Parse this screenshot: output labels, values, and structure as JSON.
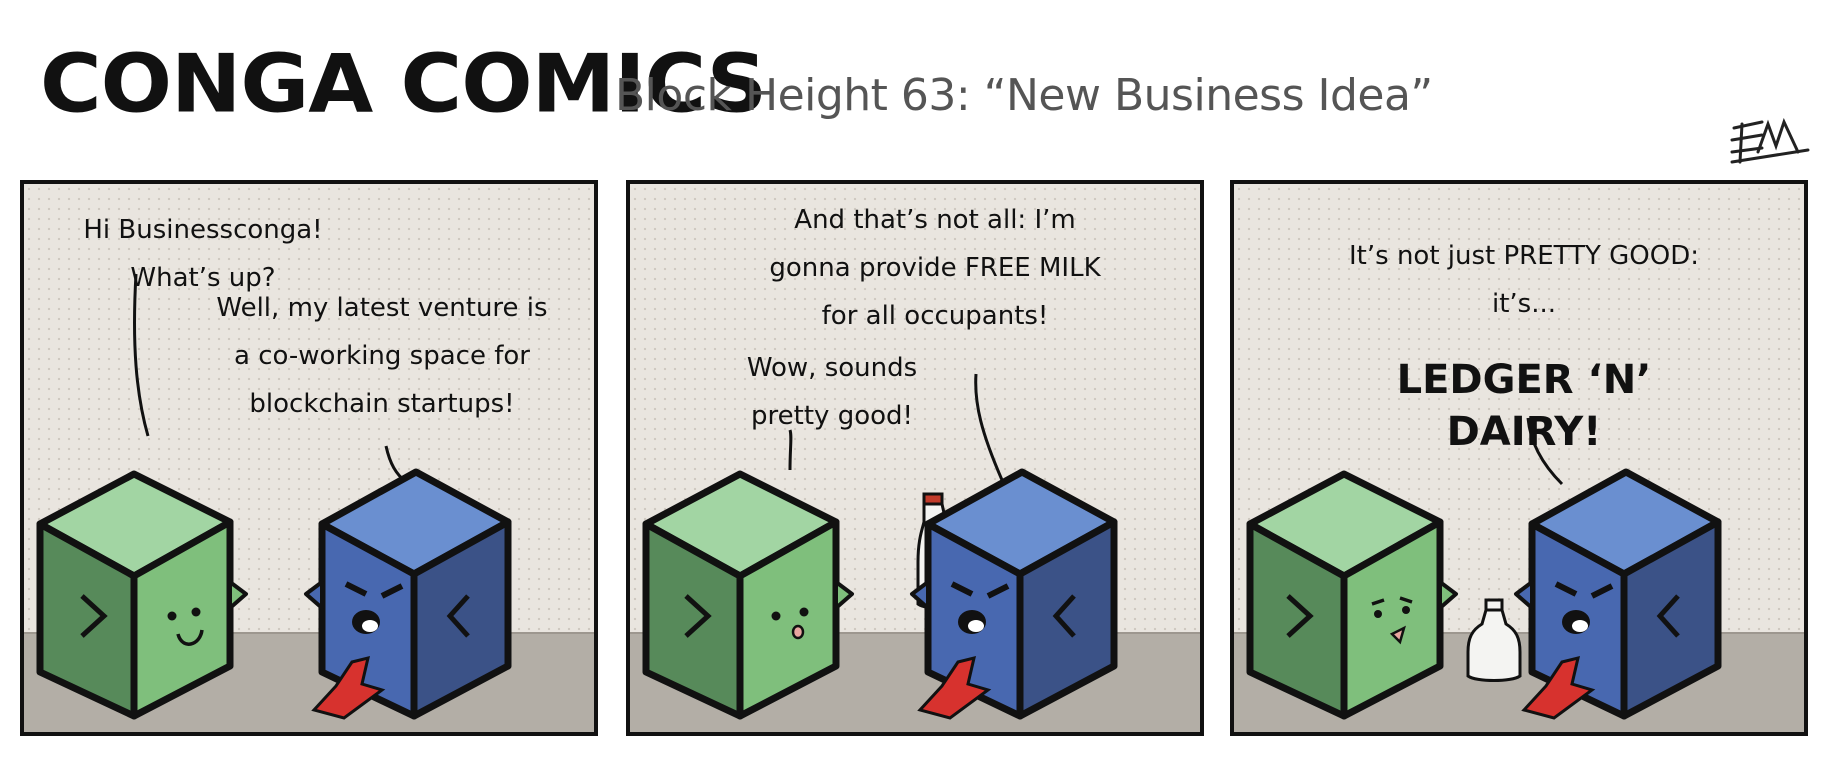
{
  "header": {
    "logo": "CONGA COMICS",
    "subtitle": "Block Height 63: “New Business Idea”",
    "signature": "EM"
  },
  "panels": [
    {
      "speech": [
        {
          "text": "Hi Businessconga! What’s up?"
        },
        {
          "text": "Well, my latest venture is\na co-working space for\nblockchain startups!"
        }
      ]
    },
    {
      "speech": [
        {
          "text": "And that’s not all: I’m\ngonna provide FREE MILK\nfor all occupants!"
        },
        {
          "text": "Wow, sounds\npretty good!"
        }
      ]
    },
    {
      "speech": [
        {
          "text": "It’s not just PRETTY GOOD:\nit’s..."
        },
        {
          "text": "LEDGER ‘N’ DAIRY!"
        }
      ]
    }
  ],
  "colors": {
    "green_top": "#a2d5a3",
    "green_front": "#7fbf7c",
    "green_side": "#578a5a",
    "blue_top": "#6a8fd0",
    "blue_front": "#4868b0",
    "blue_side": "#3b5287",
    "tie": "#d7322e",
    "floor": "#b3aea6",
    "wall": "#e9e5df"
  }
}
